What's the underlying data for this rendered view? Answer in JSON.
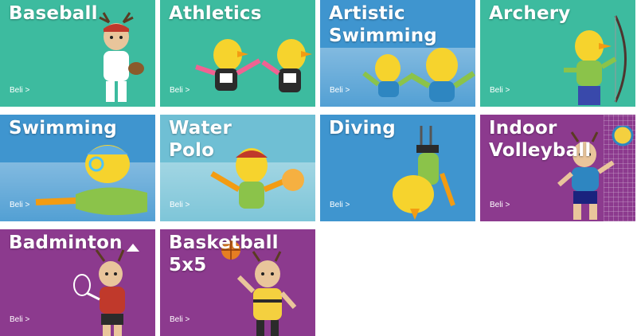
{
  "colors": {
    "teal": "#3dbb9f",
    "blue": "#3f95cf",
    "purple": "#8c3a8e",
    "water": "#7cc7dd"
  },
  "sports": [
    {
      "title": "Baseball",
      "cta": "Beli >",
      "color": "#3dbb9f",
      "mascot": "deer-mascot-baseball"
    },
    {
      "title": "Athletics",
      "cta": "Beli >",
      "color": "#3dbb9f",
      "mascot": "bird-mascot-running"
    },
    {
      "title": "Artistic\nSwimming",
      "cta": "Beli >",
      "color": "#3f95cf",
      "mascot": "bird-mascots-swimming"
    },
    {
      "title": "Archery",
      "cta": "Beli >",
      "color": "#3dbb9f",
      "mascot": "bird-mascot-archery"
    },
    {
      "title": "Swimming",
      "cta": "Beli >",
      "color": "#3f95cf",
      "mascot": "bird-mascot-swimming"
    },
    {
      "title": "Water\nPolo",
      "cta": "Beli >",
      "color": "#6fbfd4",
      "mascot": "bird-mascot-water-polo"
    },
    {
      "title": "Diving",
      "cta": "Beli >",
      "color": "#3f95cf",
      "mascot": "bird-mascot-diving"
    },
    {
      "title": "Indoor\nVolleyball",
      "cta": "Beli >",
      "color": "#8c3a8e",
      "mascot": "deer-mascot-volleyball"
    },
    {
      "title": "Badminton",
      "cta": "Beli >",
      "color": "#8c3a8e",
      "mascot": "deer-mascot-badminton"
    },
    {
      "title": "Basketball\n5x5",
      "cta": "Beli >",
      "color": "#8c3a8e",
      "mascot": "deer-mascot-basketball"
    }
  ]
}
